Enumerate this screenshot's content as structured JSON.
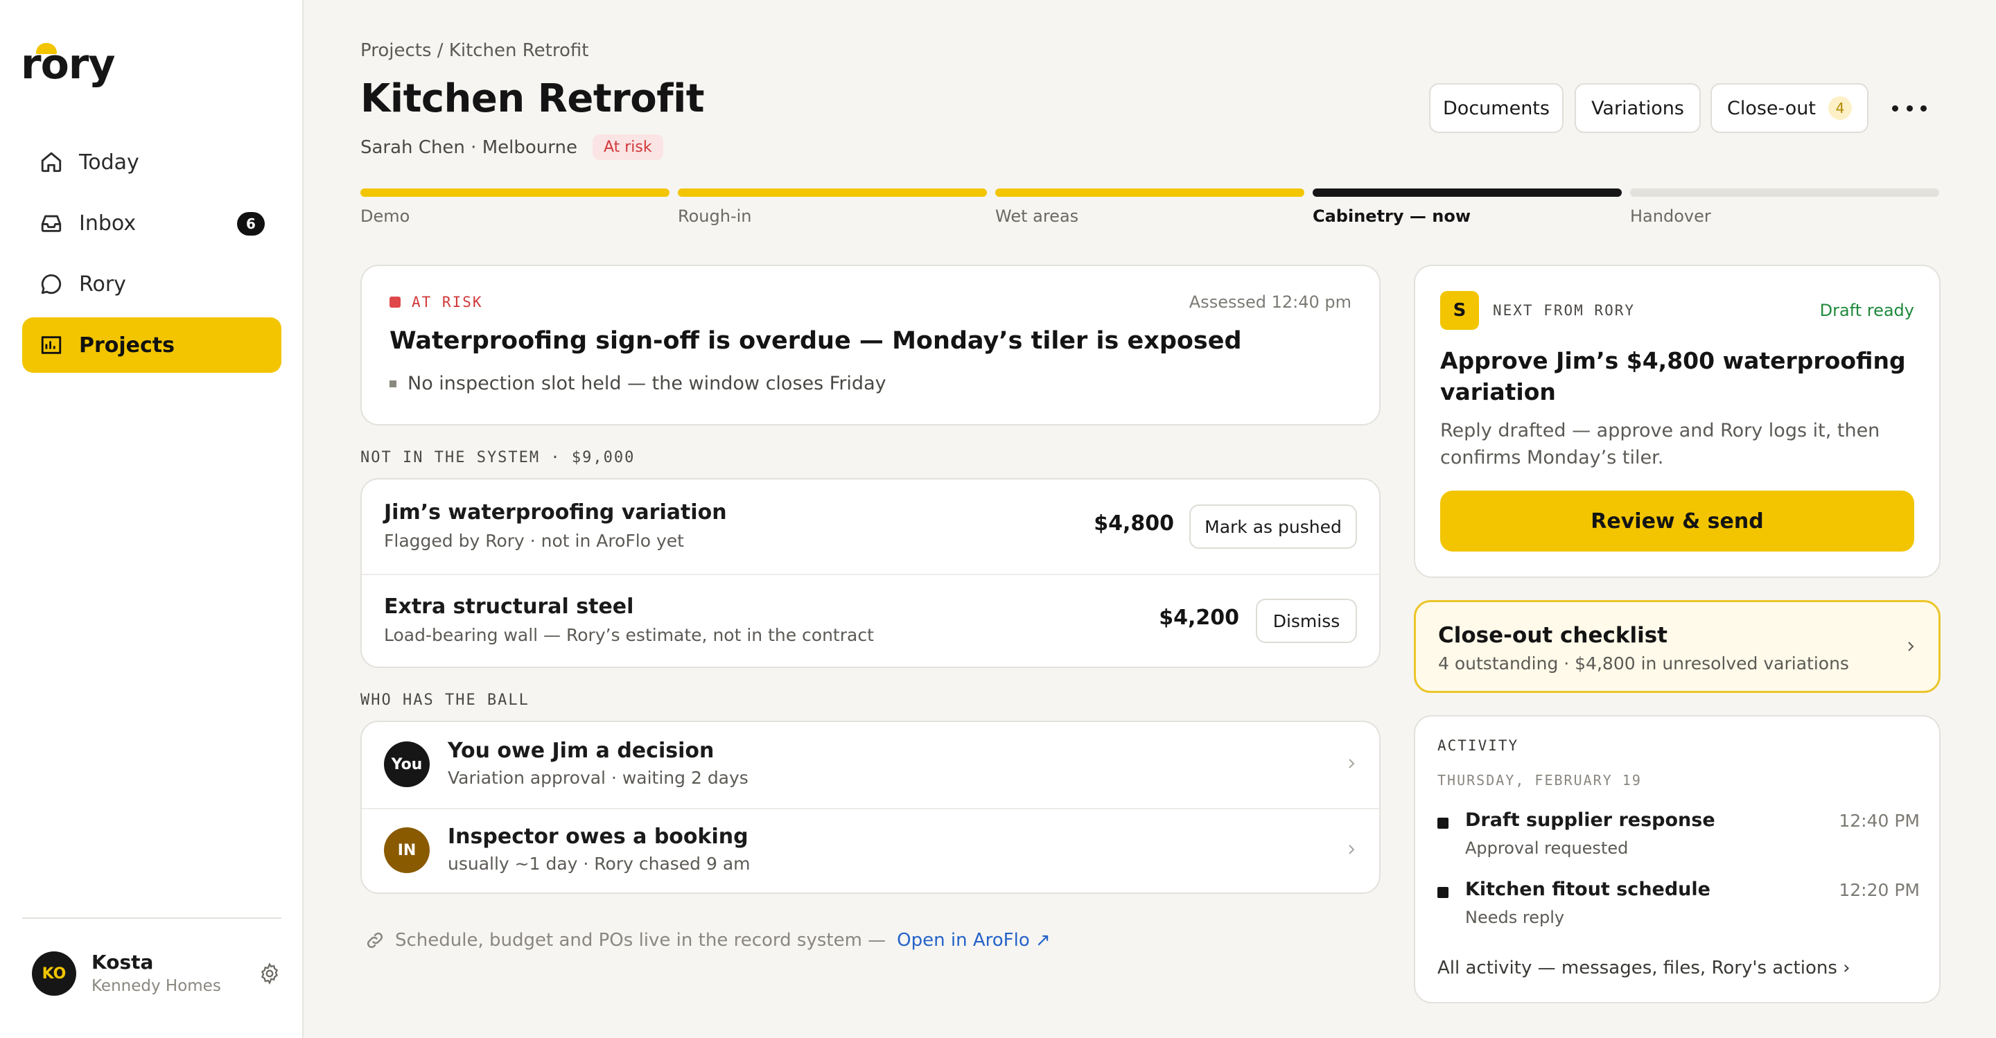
{
  "app": {
    "logo": "rory"
  },
  "sidebar": {
    "items": [
      {
        "label": "Today",
        "icon": "home-icon"
      },
      {
        "label": "Inbox",
        "icon": "inbox-icon",
        "badge": "6"
      },
      {
        "label": "Rory",
        "icon": "chat-bubble-icon"
      },
      {
        "label": "Projects",
        "icon": "projects-icon",
        "active": true
      }
    ],
    "user": {
      "initials": "KO",
      "name": "Kosta",
      "org": "Kennedy Homes"
    }
  },
  "header": {
    "breadcrumb": "Projects / Kitchen Retrofit",
    "title": "Kitchen Retrofit",
    "subtitle": "Sarah Chen · Melbourne",
    "status": "At risk",
    "buttons": {
      "documents": "Documents",
      "variations": "Variations",
      "closeout": "Close-out",
      "closeout_count": "4"
    }
  },
  "stages": [
    {
      "label": "Demo",
      "state": "done"
    },
    {
      "label": "Rough-in",
      "state": "done"
    },
    {
      "label": "Wet areas",
      "state": "done"
    },
    {
      "label": "Cabinetry — now",
      "state": "current"
    },
    {
      "label": "Handover",
      "state": "upcoming"
    }
  ],
  "risk": {
    "tag": "AT RISK",
    "assessed": "Assessed 12:40 pm",
    "title": "Waterproofing sign-off is overdue — Monday’s tiler is exposed",
    "bullet": "No inspection slot held — the window closes Friday"
  },
  "not_in_system": {
    "label": "NOT IN THE SYSTEM · $9,000",
    "rows": [
      {
        "title": "Jim’s waterproofing variation",
        "sub": "Flagged by Rory · not in AroFlo yet",
        "amount": "$4,800",
        "action": "Mark as pushed"
      },
      {
        "title": "Extra structural steel",
        "sub": "Load-bearing wall — Rory’s estimate, not in the contract",
        "amount": "$4,200",
        "action": "Dismiss"
      }
    ]
  },
  "ball": {
    "label": "WHO HAS THE BALL",
    "rows": [
      {
        "avatar": "You",
        "title": "You owe Jim a decision",
        "sub": "Variation approval · waiting 2 days",
        "color": "#161616"
      },
      {
        "avatar": "IN",
        "title": "Inspector owes a booking",
        "sub": "usually ~1 day · Rory chased 9 am",
        "color": "#8a5a00"
      }
    ]
  },
  "footer": {
    "note": "Schedule, budget and POs live in the record system —",
    "link": "Open in AroFlo ↗"
  },
  "next": {
    "badge": "S",
    "label": "NEXT FROM RORY",
    "status": "Draft ready",
    "title": "Approve Jim’s $4,800 waterproofing variation",
    "body": "Reply drafted — approve and Rory logs it, then confirms Monday’s tiler.",
    "cta": "Review & send"
  },
  "closeout": {
    "title": "Close-out checklist",
    "sub": "4 outstanding · $4,800 in unresolved variations"
  },
  "activity": {
    "label": "ACTIVITY",
    "date": "THURSDAY, FEBRUARY 19",
    "items": [
      {
        "title": "Draft supplier response",
        "sub": "Approval requested",
        "time": "12:40 PM"
      },
      {
        "title": "Kitchen fitout schedule",
        "sub": "Needs reply",
        "time": "12:20 PM"
      }
    ],
    "all_link": "All activity — messages, files, Rory's actions ›"
  },
  "colors": {
    "accent": "#f2c500",
    "risk": "#d1383a",
    "link": "#2563c9",
    "success": "#1f8a3c"
  }
}
